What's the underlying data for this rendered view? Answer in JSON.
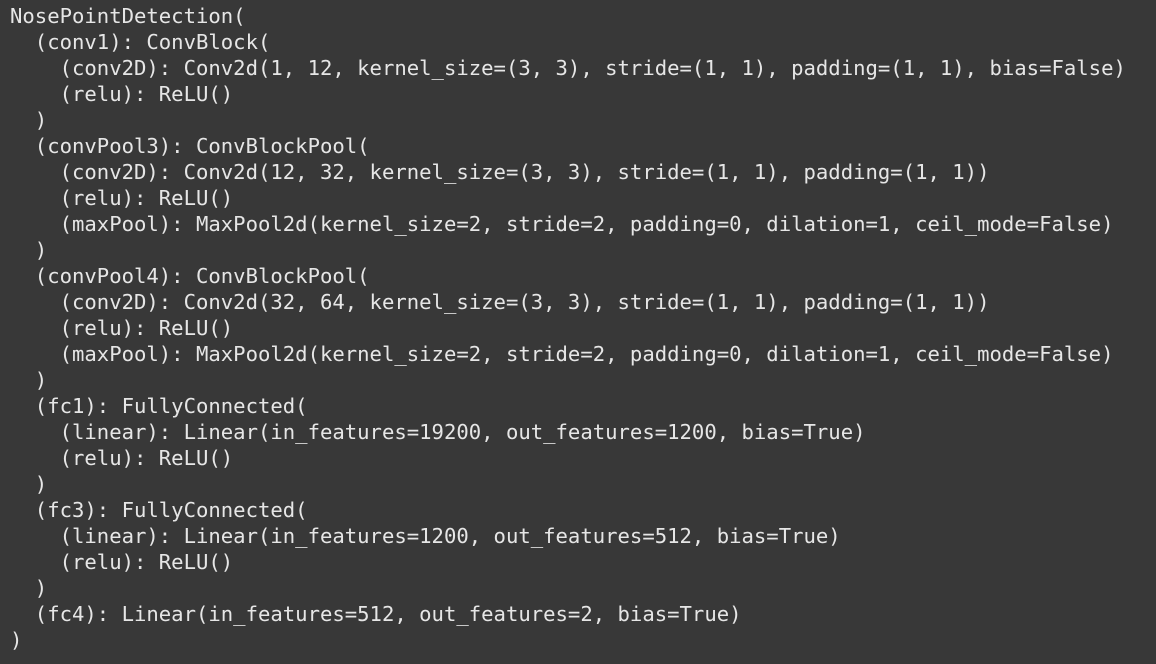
{
  "output": {
    "lines": [
      "NosePointDetection(",
      "  (conv1): ConvBlock(",
      "    (conv2D): Conv2d(1, 12, kernel_size=(3, 3), stride=(1, 1), padding=(1, 1), bias=False)",
      "    (relu): ReLU()",
      "  )",
      "  (convPool3): ConvBlockPool(",
      "    (conv2D): Conv2d(12, 32, kernel_size=(3, 3), stride=(1, 1), padding=(1, 1))",
      "    (relu): ReLU()",
      "    (maxPool): MaxPool2d(kernel_size=2, stride=2, padding=0, dilation=1, ceil_mode=False)",
      "  )",
      "  (convPool4): ConvBlockPool(",
      "    (conv2D): Conv2d(32, 64, kernel_size=(3, 3), stride=(1, 1), padding=(1, 1))",
      "    (relu): ReLU()",
      "    (maxPool): MaxPool2d(kernel_size=2, stride=2, padding=0, dilation=1, ceil_mode=False)",
      "  )",
      "  (fc1): FullyConnected(",
      "    (linear): Linear(in_features=19200, out_features=1200, bias=True)",
      "    (relu): ReLU()",
      "  )",
      "  (fc3): FullyConnected(",
      "    (linear): Linear(in_features=1200, out_features=512, bias=True)",
      "    (relu): ReLU()",
      "  )",
      "  (fc4): Linear(in_features=512, out_features=2, bias=True)",
      ")"
    ]
  },
  "colors": {
    "background": "#383838",
    "text": "#e6e6e6"
  }
}
